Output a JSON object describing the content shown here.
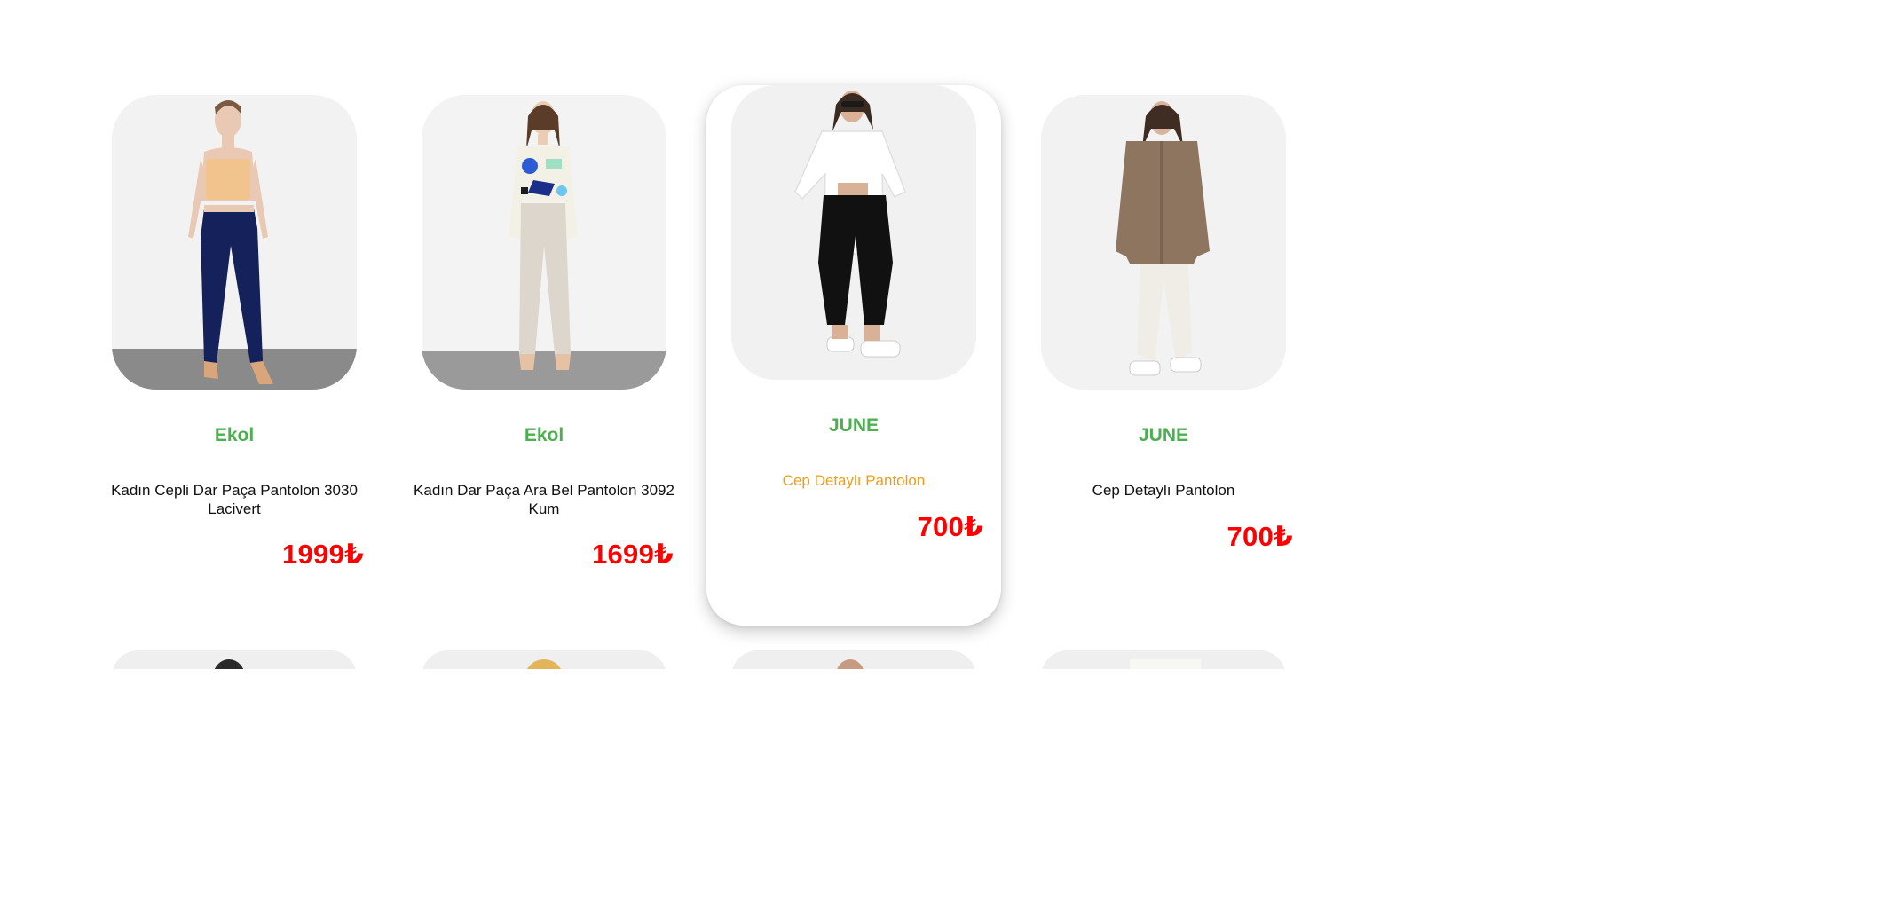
{
  "products": [
    {
      "brand": "Ekol",
      "title": "Kadın Cepli Dar Paça Pantolon 3030 Lacivert",
      "price": "1999₺",
      "photo": "product-photo-navy-trousers"
    },
    {
      "brand": "Ekol",
      "title": "Kadın Dar Paça Ara Bel Pantolon 3092 Kum",
      "price": "1699₺",
      "photo": "product-photo-sand-trousers"
    },
    {
      "brand": "JUNE",
      "title": "Cep Detaylı Pantolon",
      "price": "700₺",
      "photo": "product-photo-black-trousers"
    },
    {
      "brand": "JUNE",
      "title": "Cep Detaylı Pantolon",
      "price": "700₺",
      "photo": "product-photo-white-trousers"
    }
  ],
  "colors": {
    "brand": "#4caf50",
    "price": "#ff0000",
    "hover_title": "#f39c12",
    "text": "#111111",
    "background": "#ffffff"
  }
}
